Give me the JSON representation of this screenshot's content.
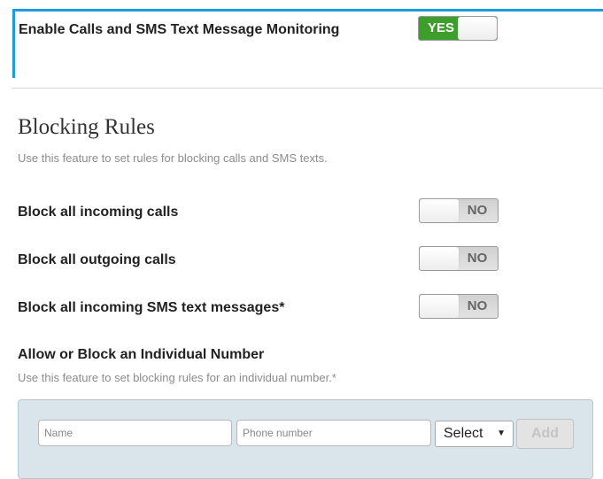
{
  "monitoring": {
    "label": "Enable Calls and SMS Text Message Monitoring",
    "toggle_state": "YES"
  },
  "blocking_rules": {
    "title": "Blocking Rules",
    "description": "Use this feature to set rules for blocking calls and SMS texts.",
    "rules": [
      {
        "label": "Block all incoming calls",
        "toggle_state": "NO"
      },
      {
        "label": "Block all outgoing calls",
        "toggle_state": "NO"
      },
      {
        "label": "Block all incoming SMS text messages*",
        "toggle_state": "NO"
      }
    ]
  },
  "individual_number": {
    "title": "Allow or Block an Individual Number",
    "description": "Use this feature to set blocking rules for an individual number.*",
    "name_placeholder": "Name",
    "phone_placeholder": "Phone number",
    "select_value": "Select",
    "add_label": "Add"
  },
  "colors": {
    "accent_border": "#1d9ad9",
    "toggle_on": "#3d9e2c",
    "panel_background": "#d9e5ea"
  }
}
